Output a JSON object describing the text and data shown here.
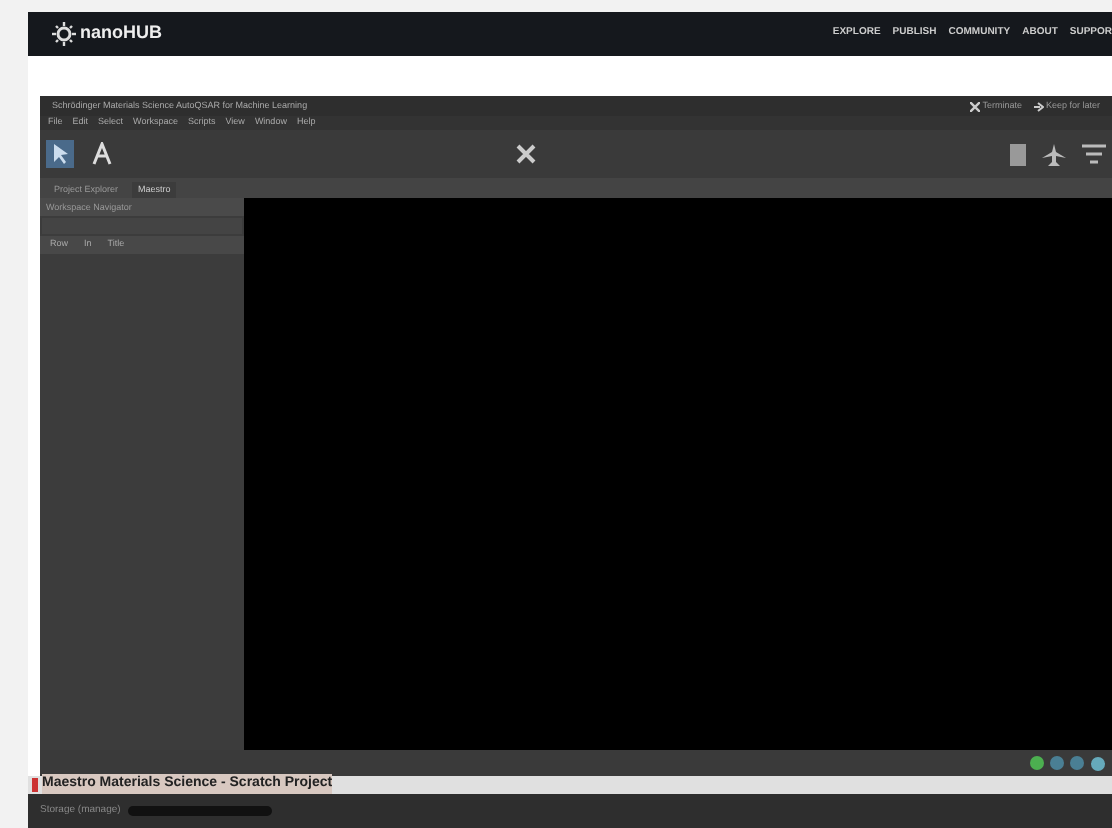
{
  "site": {
    "logo": "nanoHUB",
    "nav": [
      "EXPLORE",
      "PUBLISH",
      "COMMUNITY",
      "ABOUT",
      "SUPPOR"
    ]
  },
  "window": {
    "title": "Schrödinger Materials Science AutoQSAR for Machine Learning",
    "actions": [
      {
        "label": "Terminate",
        "kind": "close"
      },
      {
        "label": "Keep for later",
        "kind": "keep"
      }
    ]
  },
  "menu": [
    "File",
    "Edit",
    "Select",
    "Workspace",
    "Scripts",
    "View",
    "Window",
    "Help"
  ],
  "tabs": [
    {
      "label": "Project Explorer",
      "selected": false
    },
    {
      "label": "Maestro",
      "selected": true
    }
  ],
  "navigator": {
    "title": "Workspace Navigator",
    "columns": [
      "Row",
      "In",
      "Title"
    ]
  },
  "project_bar": {
    "title": "Maestro Materials Science - Scratch Project"
  },
  "footer": {
    "storage": "Storage (manage)"
  }
}
